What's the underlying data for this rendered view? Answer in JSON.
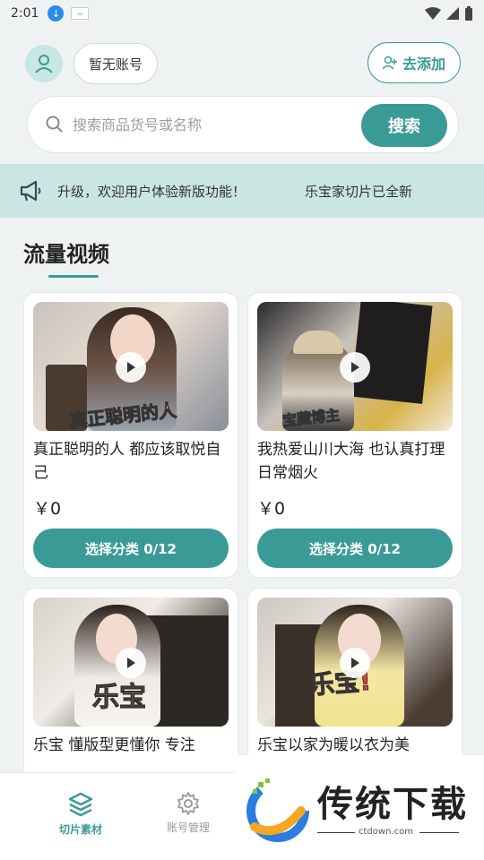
{
  "status_bar": {
    "time": "2:01"
  },
  "header": {
    "account_label": "暂无账号",
    "add_label": "去添加"
  },
  "search": {
    "placeholder": "搜索商品货号或名称",
    "button": "搜索"
  },
  "notice": {
    "text": "升级，欢迎用户体验新版功能！",
    "text2": "乐宝家切片已全新"
  },
  "section": {
    "title": "流量视频"
  },
  "cards": [
    {
      "title": "真正聪明的人 都应该取悦自己",
      "price": "￥0",
      "button": "选择分类 0/12",
      "caption": "真正聪明的人"
    },
    {
      "title": "我热爱山川大海 也认真打理日常烟火",
      "price": "￥0",
      "button": "选择分类 0/12",
      "caption": "宝藏博主"
    },
    {
      "title": "乐宝 懂版型更懂你 专注",
      "caption": "乐宝"
    },
    {
      "title": "乐宝以家为暖以衣为美",
      "caption": "乐宝!"
    }
  ],
  "bottom_nav": {
    "tab1": "切片素材",
    "tab2": "账号管理"
  },
  "watermark": {
    "text": "传统下载",
    "url": "ctdown.com"
  },
  "colors": {
    "accent": "#3a9b96",
    "notice_bg": "#c9e6e3"
  }
}
